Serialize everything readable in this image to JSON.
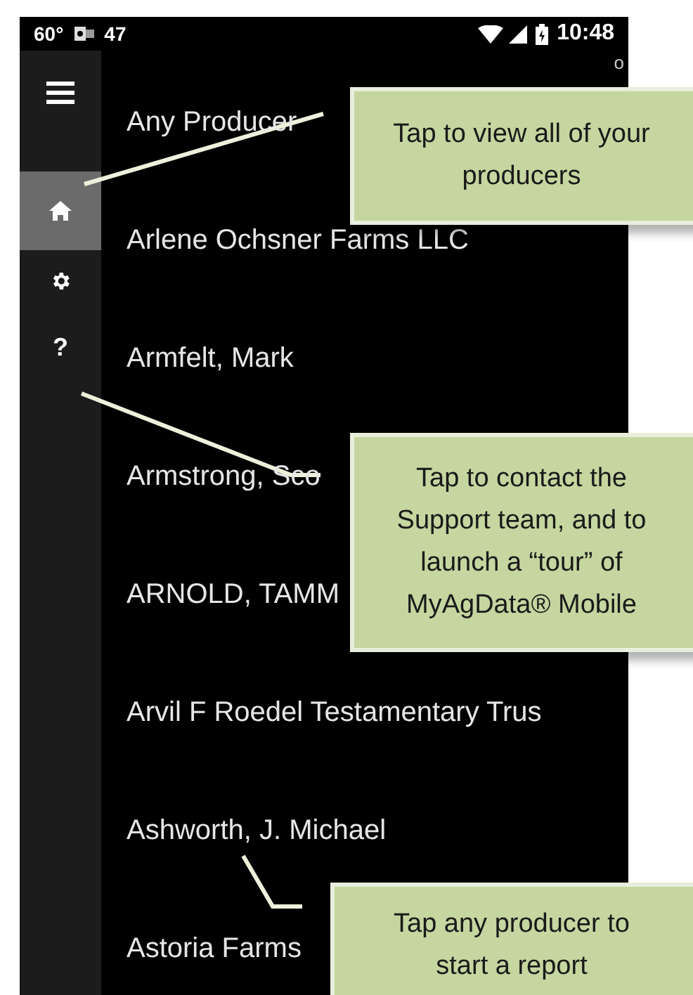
{
  "status_bar": {
    "temperature": "60°",
    "notification_count": "47",
    "time": "10:48"
  },
  "sidebar": {
    "items": [
      {
        "kind": "home",
        "selected": true
      },
      {
        "kind": "settings",
        "selected": false
      },
      {
        "kind": "help",
        "label": "?",
        "selected": false
      }
    ]
  },
  "corner_glyph": "o",
  "producers": [
    "Any Producer",
    "Arlene Ochsner Farms LLC",
    "Armfelt, Mark",
    "Armstrong, Sco",
    "ARNOLD, TAMM",
    "Arvil F Roedel Testamentary Trus",
    "Ashworth, J. Michael",
    "Astoria Farms"
  ],
  "callouts": [
    {
      "lines": [
        "Tap to view all of your",
        "producers"
      ]
    },
    {
      "lines": [
        "Tap to contact the",
        "Support team, and to",
        "launch a “tour” of",
        "MyAgData® Mobile"
      ]
    },
    {
      "lines": [
        "Tap any producer to",
        "start a report"
      ]
    }
  ]
}
